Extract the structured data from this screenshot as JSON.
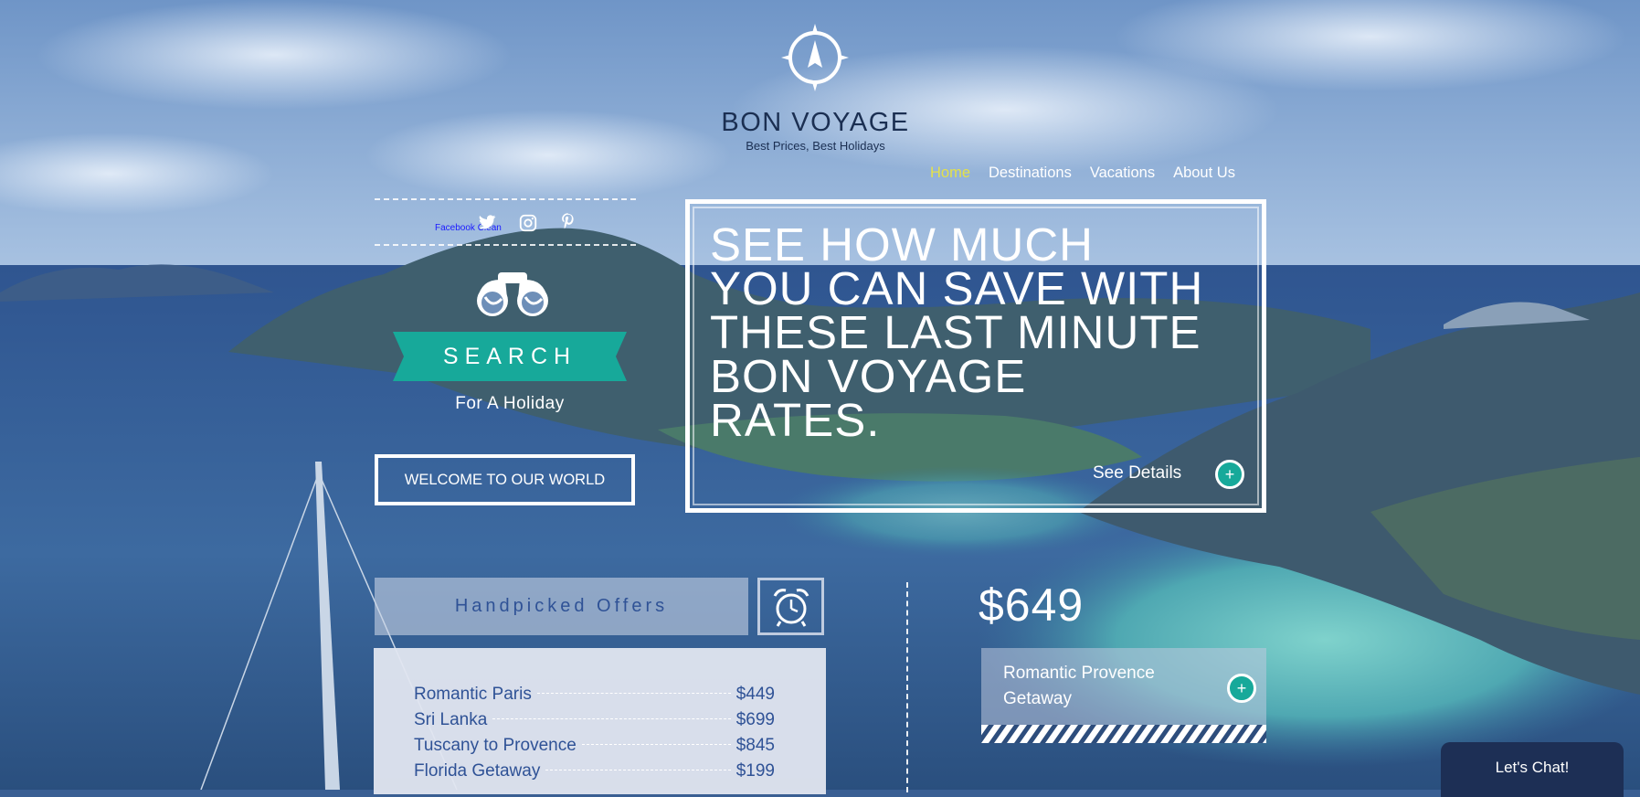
{
  "brand": {
    "name": "BON VOYAGE",
    "tagline": "Best Prices, Best Holidays"
  },
  "nav": {
    "items": [
      "Home",
      "Destinations",
      "Vacations",
      "About Us"
    ],
    "active": "Home"
  },
  "social": {
    "facebook_alt": "Facebook Clean",
    "icons": [
      "twitter-icon",
      "instagram-icon",
      "pinterest-icon"
    ]
  },
  "search": {
    "label": "SEARCH",
    "sub": "For A Holiday"
  },
  "welcome_button": "WELCOME TO OUR WORLD",
  "promo": {
    "headline_lines": [
      "SEE HOW MUCH",
      "YOU CAN SAVE WITH",
      "THESE LAST MINUTE",
      "BON VOYAGE",
      "RATES."
    ],
    "details_label": "See Details",
    "details_icon": "+"
  },
  "handpicked": {
    "title": "Handpicked Offers",
    "offers": [
      {
        "name": "Romantic Paris",
        "price": "$449"
      },
      {
        "name": "Sri Lanka",
        "price": "$699"
      },
      {
        "name": "Tuscany to Provence",
        "price": "$845"
      },
      {
        "name": "Florida Getaway",
        "price": "$199"
      }
    ]
  },
  "featured": {
    "price": "$649",
    "title_lines": [
      "Romantic Provence",
      "Getaway"
    ],
    "icon": "+"
  },
  "chat": {
    "label": "Let's Chat!"
  },
  "colors": {
    "accent_teal": "#17a99a",
    "nav_active": "#e4e14a",
    "brand_navy": "#1b2f52",
    "offer_text": "#2f5296"
  }
}
